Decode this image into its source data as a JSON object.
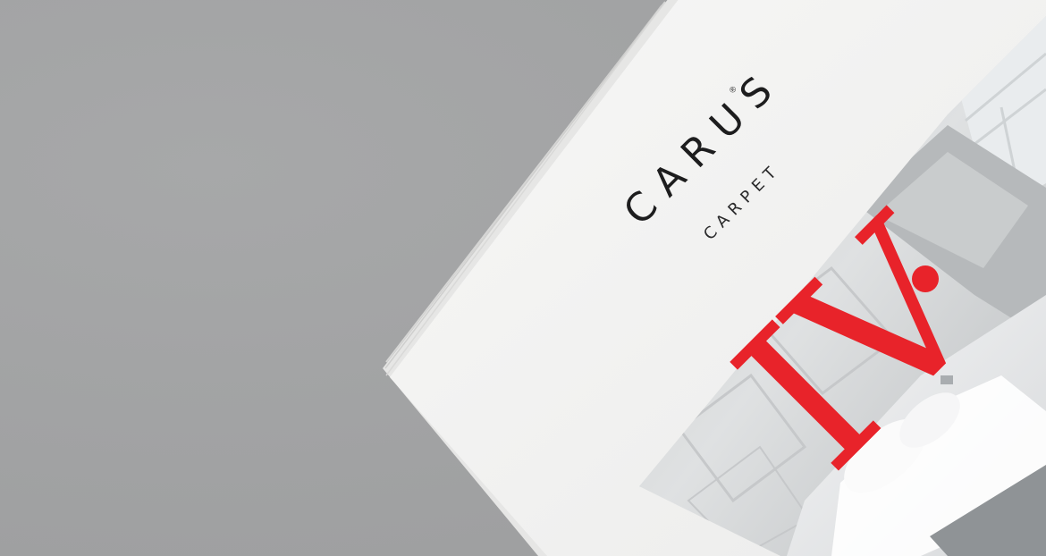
{
  "cover": {
    "brand_name": "CARUS",
    "registered_mark": "®",
    "brand_subtitle": "CARPET",
    "volume_numeral": "IV",
    "numeral_color": "#e8232a"
  },
  "colors": {
    "background": "#a3a4a5",
    "cover_white": "#f3f3f2",
    "text_dark": "#1d1d1e"
  }
}
